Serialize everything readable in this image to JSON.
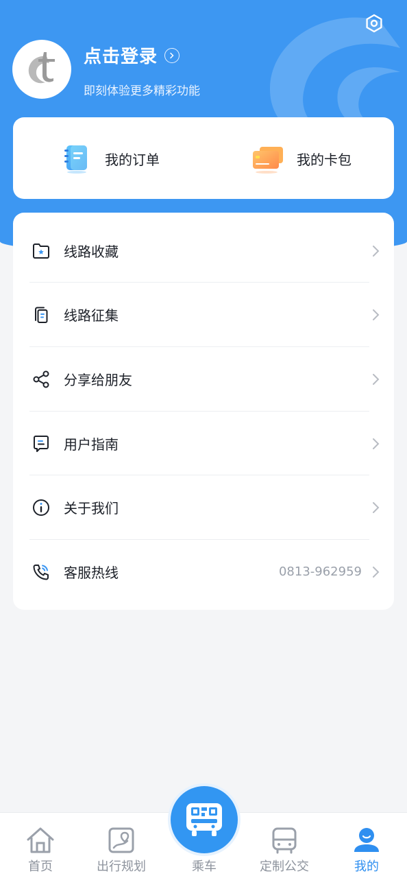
{
  "profile": {
    "login_title": "点击登录",
    "login_subtitle": "即刻体验更多精彩功能"
  },
  "quick_links": [
    {
      "label": "我的订单",
      "icon": "orders-notebook-icon"
    },
    {
      "label": "我的卡包",
      "icon": "card-wallet-icon"
    }
  ],
  "menu": [
    {
      "label": "线路收藏",
      "icon": "folder-star-icon",
      "value": ""
    },
    {
      "label": "线路征集",
      "icon": "document-copy-icon",
      "value": ""
    },
    {
      "label": "分享给朋友",
      "icon": "share-icon",
      "value": ""
    },
    {
      "label": "用户指南",
      "icon": "message-guide-icon",
      "value": ""
    },
    {
      "label": "关于我们",
      "icon": "info-icon",
      "value": ""
    },
    {
      "label": "客服热线",
      "icon": "phone-icon",
      "value": "0813-962959"
    }
  ],
  "tabbar": {
    "items": [
      {
        "label": "首页",
        "icon": "home-icon"
      },
      {
        "label": "出行规划",
        "icon": "map-route-icon"
      },
      {
        "label": "乘车",
        "icon": "bus-qrcode-icon"
      },
      {
        "label": "定制公交",
        "icon": "bus-icon"
      },
      {
        "label": "我的",
        "icon": "user-icon"
      }
    ],
    "active": "我的"
  },
  "colors": {
    "primary": "#3d97f2",
    "active_tab": "#2f8ff0",
    "inactive_tab": "#8d939d",
    "background": "#f4f5f7"
  }
}
